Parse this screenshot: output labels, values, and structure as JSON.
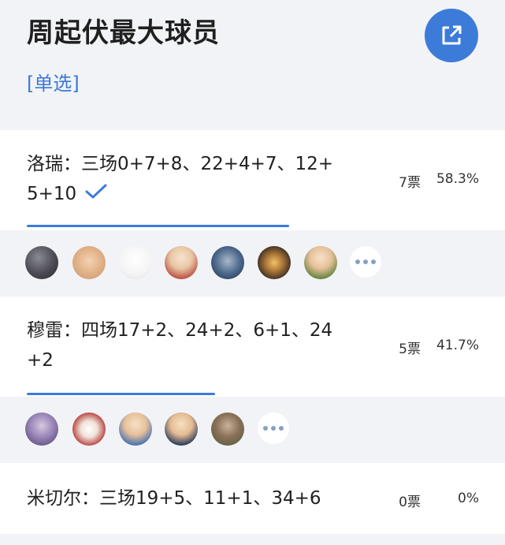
{
  "poll": {
    "title": "周起伏最大球员",
    "type_label": "[单选]"
  },
  "colors": {
    "accent": "#3d7bd9",
    "background": "#f2f3f7"
  },
  "options": [
    {
      "text": "洛瑞：三场0+7+8、22+4+7、12+5+10",
      "votes": "7票",
      "percent": "58.3%",
      "fraction": 0.583,
      "selected": true,
      "avatars": [
        "avatar-1",
        "avatar-2",
        "avatar-3",
        "avatar-4",
        "avatar-5",
        "avatar-6",
        "avatar-7"
      ]
    },
    {
      "text": "穆雷：四场17+2、24+2、6+1、24+2",
      "votes": "5票",
      "percent": "41.7%",
      "fraction": 0.417,
      "selected": false,
      "avatars": [
        "avatar-1",
        "avatar-2",
        "avatar-3",
        "avatar-4",
        "avatar-5"
      ]
    },
    {
      "text": "米切尔：三场19+5、11+1、34+6",
      "votes": "0票",
      "percent": "0%",
      "fraction": 0,
      "selected": false,
      "avatars": []
    }
  ]
}
